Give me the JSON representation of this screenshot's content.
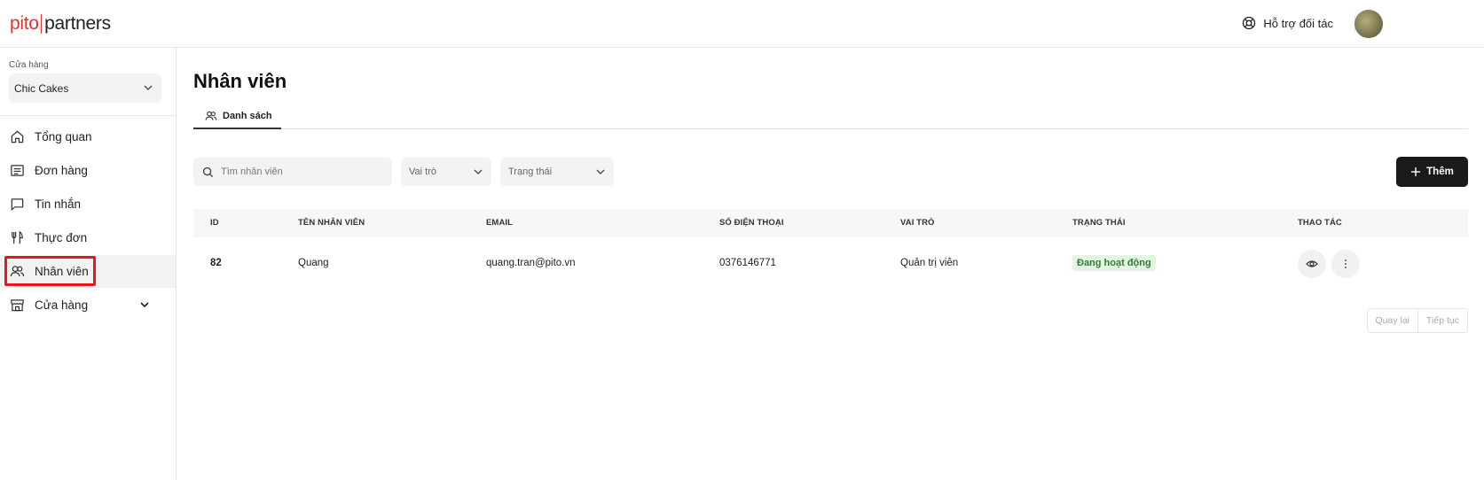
{
  "brand": {
    "logo_left": "pito",
    "logo_right": "partners"
  },
  "header": {
    "support_label": "Hỗ trợ đối tác"
  },
  "sidebar": {
    "store_label": "Cửa hàng",
    "store_value": "Chic Cakes",
    "items": [
      {
        "label": "Tổng quan",
        "icon": "home-icon"
      },
      {
        "label": "Đơn hàng",
        "icon": "receipt-icon"
      },
      {
        "label": "Tin nhắn",
        "icon": "message-icon"
      },
      {
        "label": "Thực đơn",
        "icon": "utensils-icon"
      },
      {
        "label": "Nhân viên",
        "icon": "users-icon",
        "active": true
      },
      {
        "label": "Cửa hàng",
        "icon": "store-icon",
        "expandable": true
      }
    ]
  },
  "main": {
    "title": "Nhân viên",
    "tab_label": "Danh sách",
    "search_placeholder": "Tìm nhân viên",
    "role_filter": "Vai trò",
    "status_filter": "Trạng thái",
    "add_label": "Thêm"
  },
  "table": {
    "columns": [
      "ID",
      "TÊN NHÂN VIÊN",
      "EMAIL",
      "SỐ ĐIỆN THOẠI",
      "VAI TRÒ",
      "TRẠNG THÁI",
      "THAO TÁC"
    ],
    "rows": [
      {
        "id": "82",
        "name": "Quang",
        "email": "quang.tran@pito.vn",
        "phone": "0376146771",
        "role": "Quản trị viên",
        "status": "Đang hoạt động"
      }
    ]
  },
  "pagination": {
    "prev": "Quay lại",
    "next": "Tiếp tục"
  },
  "colors": {
    "accent": "#e0312a",
    "highlight_border": "#e8151b",
    "button_dark": "#1a1a1a",
    "status_bg": "#e3f5e2",
    "status_text": "#2e7d32"
  }
}
